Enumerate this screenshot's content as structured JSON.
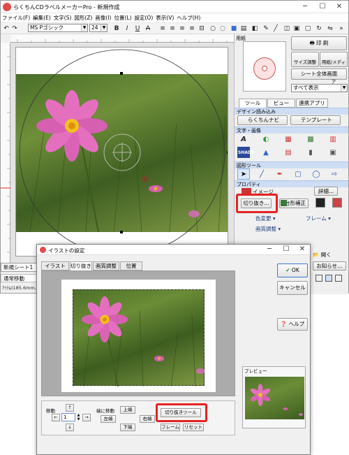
{
  "app": {
    "title": "らくちんCDラベルメーカーPro - 新規作成",
    "menu": [
      "ファイル(F)",
      "編集(E)",
      "文字(S)",
      "図形(Z)",
      "画像(I)",
      "位置(L)",
      "設定(O)",
      "表示(V)",
      "ヘルプ(H)"
    ],
    "font_name": "MS Pゴシック",
    "font_size": "24",
    "format_buttons": [
      "B",
      "I",
      "U",
      "A"
    ]
  },
  "sheet_tab": "新規シート1",
  "status_mode": "通常移動",
  "status_coords": "ｱｲﾃﾑ(185.6mm,190.",
  "right_panel": {
    "paper_label": "用紙",
    "print_label": "印 刷",
    "size_adjust_label": "サイズ調整",
    "paper_media_label": "用紙/メディア",
    "sheet_overview_label": "シート全体画面",
    "show_all": "すべて表示",
    "tabs": [
      "ツール",
      "ビュー",
      "連携アプリ"
    ],
    "sect_design": "デザイン読み込み",
    "rakuchin_navi": "らくちんナビ",
    "template": "テンプレート",
    "sect_text_image": "文字・画像",
    "sect_shape_tool": "図形ツール",
    "sect_property": "プロパティ",
    "image_label": "イメージ",
    "detail_label": "詳細...",
    "crop_label": "切り抜き...",
    "trapezoid_label": "台形補正",
    "color_change": "色変更",
    "frame": "フレーム",
    "image_adjust": "画質調整",
    "open_label": "開く",
    "notice_label": "お知らせ"
  },
  "dialog": {
    "title": "イラストの設定",
    "tabs": [
      "イラスト",
      "切り抜き",
      "画質調整",
      "位置"
    ],
    "ok": "OK",
    "cancel": "キャンセル",
    "help": "ヘルプ",
    "preview_label": "プレビュー",
    "move_label": "移動",
    "move_value": "1",
    "edge_move_label": "端に移動",
    "left_label": "左端",
    "top_label": "上端",
    "right_label": "右端",
    "bottom_label": "下端",
    "crop_tool": "切り抜きツール",
    "frame": "フレーム",
    "reset": "リセット"
  },
  "colors": {
    "accent_red": "#e52222",
    "section_blue": "#cdddf3",
    "tab_active": "#ffffff"
  }
}
